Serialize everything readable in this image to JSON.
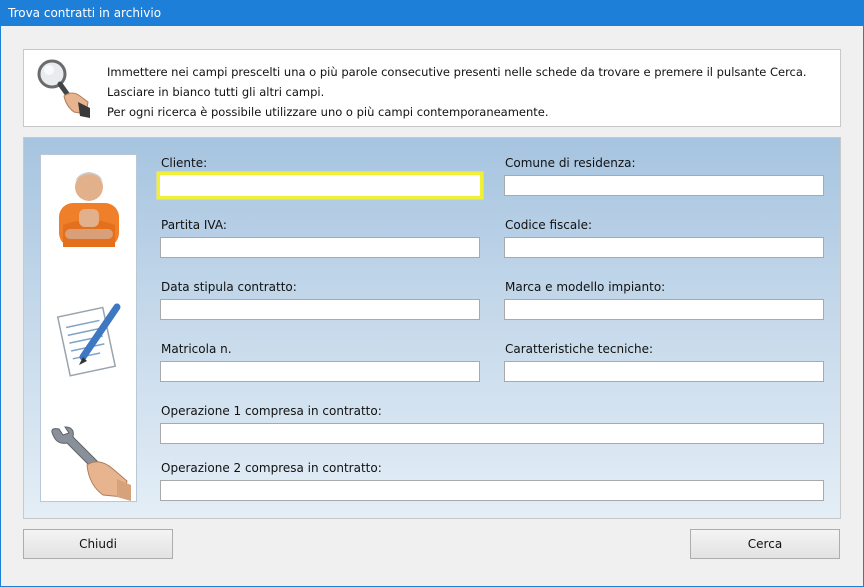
{
  "window": {
    "title": "Trova contratti in archivio"
  },
  "info": {
    "lines": [
      "Immettere nei campi prescelti una o più parole consecutive presenti nelle schede da trovare e premere il pulsante Cerca.",
      "Lasciare in bianco tutti gli altri campi.",
      "Per ogni ricerca è possibile utilizzare uno o più campi contemporaneamente."
    ]
  },
  "form": {
    "cliente": {
      "label": "Cliente:",
      "value": ""
    },
    "comune": {
      "label": "Comune di residenza:",
      "value": ""
    },
    "partita_iva": {
      "label": "Partita IVA:",
      "value": ""
    },
    "codice_fiscale": {
      "label": "Codice fiscale:",
      "value": ""
    },
    "data_stipula": {
      "label": "Data stipula contratto:",
      "value": ""
    },
    "marca_modello": {
      "label": "Marca e modello impianto:",
      "value": ""
    },
    "matricola": {
      "label": "Matricola n.",
      "value": ""
    },
    "caratteristiche": {
      "label": "Caratteristiche tecniche:",
      "value": ""
    },
    "operazione1": {
      "label": "Operazione 1 compresa in contratto:",
      "value": ""
    },
    "operazione2": {
      "label": "Operazione 2 compresa in contratto:",
      "value": ""
    }
  },
  "buttons": {
    "close": "Chiudi",
    "search": "Cerca"
  },
  "colors": {
    "titlebar": "#1e7fd8",
    "focus_border": "#f0f036",
    "panel_top": "#a6c4e0",
    "panel_bottom": "#e4eef6"
  },
  "icons": [
    "magnifier-hand-icon",
    "person-photo",
    "notepad-pen-icon",
    "wrench-hand-icon"
  ]
}
